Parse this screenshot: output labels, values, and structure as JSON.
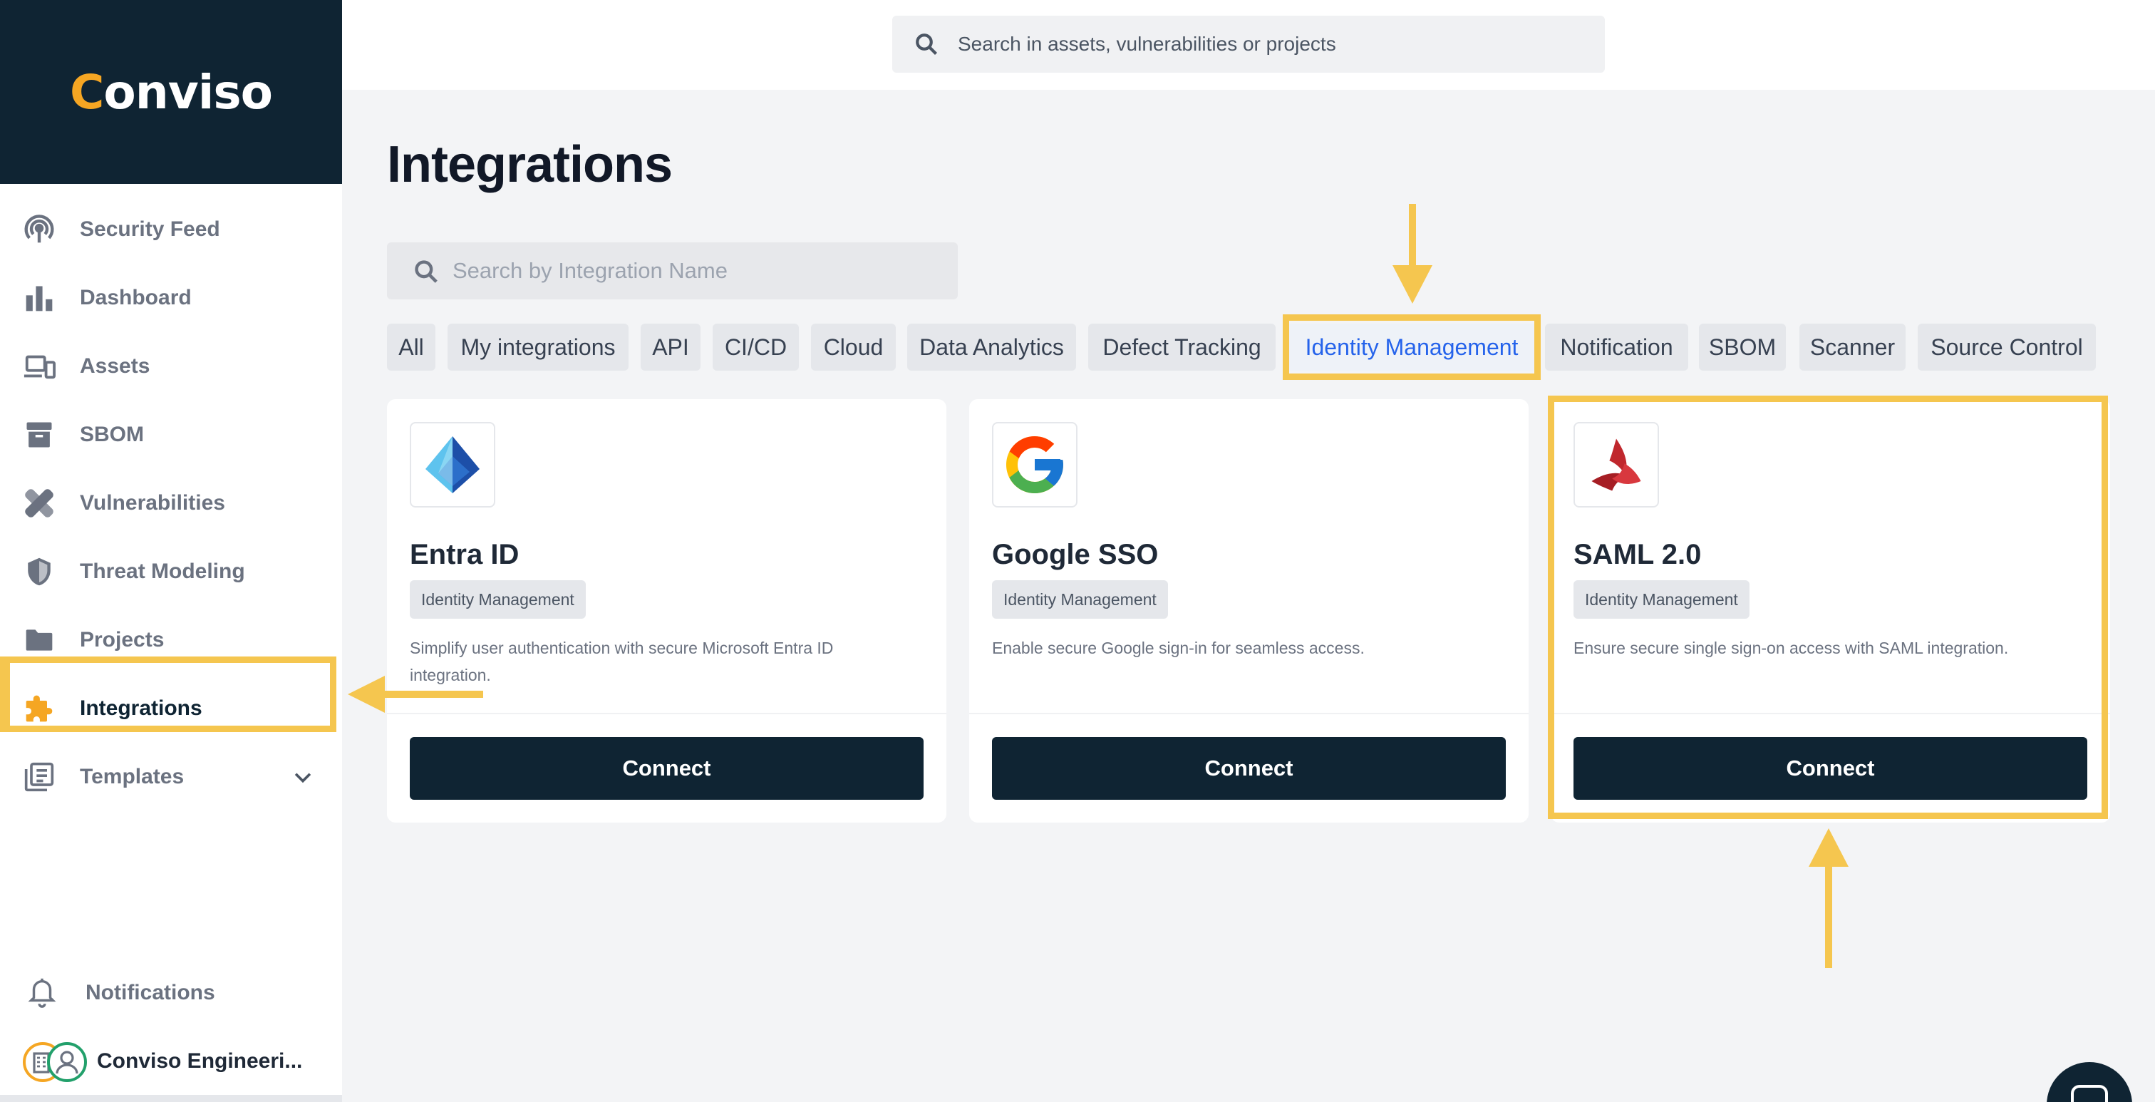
{
  "brand": {
    "name": "Conviso",
    "accent": "#f5a623",
    "dark": "#0f2433",
    "highlight": "#f5c64f"
  },
  "global_search": {
    "placeholder": "Search in assets, vulnerabilities or projects",
    "icon": "search-icon"
  },
  "sidebar": {
    "items": [
      {
        "label": "Security Feed",
        "icon": "podcast-icon"
      },
      {
        "label": "Dashboard",
        "icon": "bar-chart-icon"
      },
      {
        "label": "Assets",
        "icon": "devices-icon"
      },
      {
        "label": "SBOM",
        "icon": "archive-icon"
      },
      {
        "label": "Vulnerabilities",
        "icon": "bandage-icon"
      },
      {
        "label": "Threat Modeling",
        "icon": "shield-icon"
      },
      {
        "label": "Projects",
        "icon": "folder-icon"
      },
      {
        "label": "Integrations",
        "icon": "puzzle-icon",
        "active": true
      },
      {
        "label": "Templates",
        "icon": "templates-icon"
      }
    ],
    "notifications_label": "Notifications",
    "user_label": "Conviso Engineeri..."
  },
  "page": {
    "title": "Integrations",
    "search_placeholder": "Search by Integration Name"
  },
  "filters": {
    "chips": [
      "All",
      "My integrations",
      "API",
      "CI/CD",
      "Cloud",
      "Data Analytics",
      "Defect Tracking",
      "Identity Management",
      "Notification",
      "SBOM",
      "Scanner",
      "Source Control"
    ],
    "active": "Identity Management"
  },
  "cards": [
    {
      "name": "Entra ID",
      "tag": "Identity Management",
      "description": "Simplify user authentication with secure Microsoft Entra ID integration.",
      "button": "Connect",
      "logo": "entra-id-icon"
    },
    {
      "name": "Google SSO",
      "tag": "Identity Management",
      "description": "Enable secure Google sign-in for seamless access.",
      "button": "Connect",
      "logo": "google-icon"
    },
    {
      "name": "SAML 2.0",
      "tag": "Identity Management",
      "description": "Ensure secure single sign-on access with SAML integration.",
      "button": "Connect",
      "logo": "saml-icon"
    }
  ]
}
